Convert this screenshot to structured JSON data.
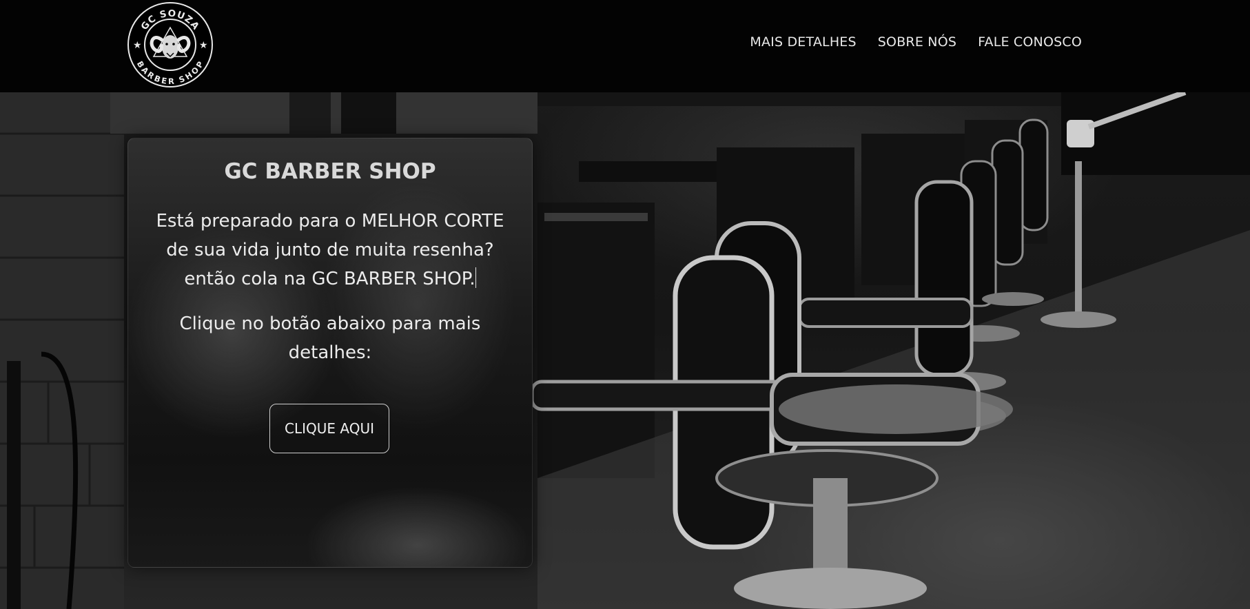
{
  "header": {
    "logo": {
      "icon": "ram-head-logo",
      "top_text": "GC SOUZA",
      "bottom_text": "BARBER SHOP"
    },
    "nav": [
      {
        "label": "MAIS DETALHES"
      },
      {
        "label": "SOBRE NÓS"
      },
      {
        "label": "FALE CONOSCO"
      }
    ]
  },
  "hero": {
    "background_image": "barbershop-chairs-photo"
  },
  "card": {
    "title": "GC BARBER SHOP",
    "intro": "Está preparado para o MELHOR CORTE de sua vida junto de muita resenha? então cola na GC BARBER SHOP.",
    "cta_text": "Clique no botão abaixo para mais detalhes:",
    "button_label": "CLIQUE AQUI"
  },
  "colors": {
    "header_bg": "#030303",
    "text_light": "#ececec",
    "button_border": "#cfcfcf"
  }
}
